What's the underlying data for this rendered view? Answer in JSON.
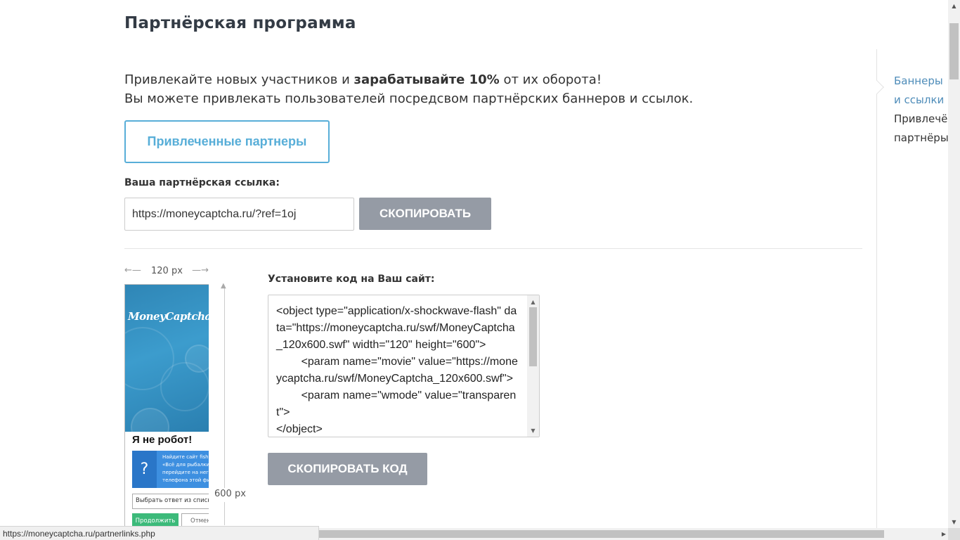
{
  "page": {
    "title": "Партнёрская программа"
  },
  "intro": {
    "line1_before": "Привлекайте новых участников и ",
    "line1_bold": "зарабатывайте 10%",
    "line1_after": " от их оборота!",
    "line2": "Вы можете привлекать пользователей посредсвом партнёрских баннеров и ссылок."
  },
  "referred_button": "Привлеченные партнеры",
  "partner_link": {
    "label": "Ваша партнёрская ссылка:",
    "value": "https://moneycaptcha.ru/?ref=1oj",
    "copy_button": "СКОПИРОВАТЬ"
  },
  "banner": {
    "width_label": "120 px",
    "height_label": "600 px",
    "logo": "MoneyCaptcha",
    "robot_title": "Я не робот!",
    "question_icon": "?",
    "question_text_lines": [
      "Найдите сайт fishr",
      "«Всё для рыбалки",
      "перейдите на него",
      "телефона этой фи"
    ],
    "answer_placeholder": "Выбрать ответ из списка",
    "continue_label": "Продолжить",
    "cancel_label": "Отмена"
  },
  "code": {
    "label": "Установите код на Ваш сайт:",
    "snippet": "<object type=\"application/x-shockwave-flash\" data=\"https://moneycaptcha.ru/swf/MoneyCaptcha_120x600.swf\" width=\"120\" height=\"600\">\n\t<param name=\"movie\" value=\"https://moneycaptcha.ru/swf/MoneyCaptcha_120x600.swf\">\n\t<param name=\"wmode\" value=\"transparent\">\n</object>",
    "copy_button": "СКОПИРОВАТЬ КОД"
  },
  "side_nav": {
    "items": [
      {
        "label": "Баннеры и ссылки",
        "active": true
      },
      {
        "label": "Привлечённые партнёры",
        "active": false
      }
    ]
  },
  "status_bar": {
    "url": "https://moneycaptcha.ru/partnerlinks.php"
  },
  "colors": {
    "accent": "#58aed8",
    "button_gray": "#959ba5",
    "nav_active": "#4e8cb9"
  }
}
